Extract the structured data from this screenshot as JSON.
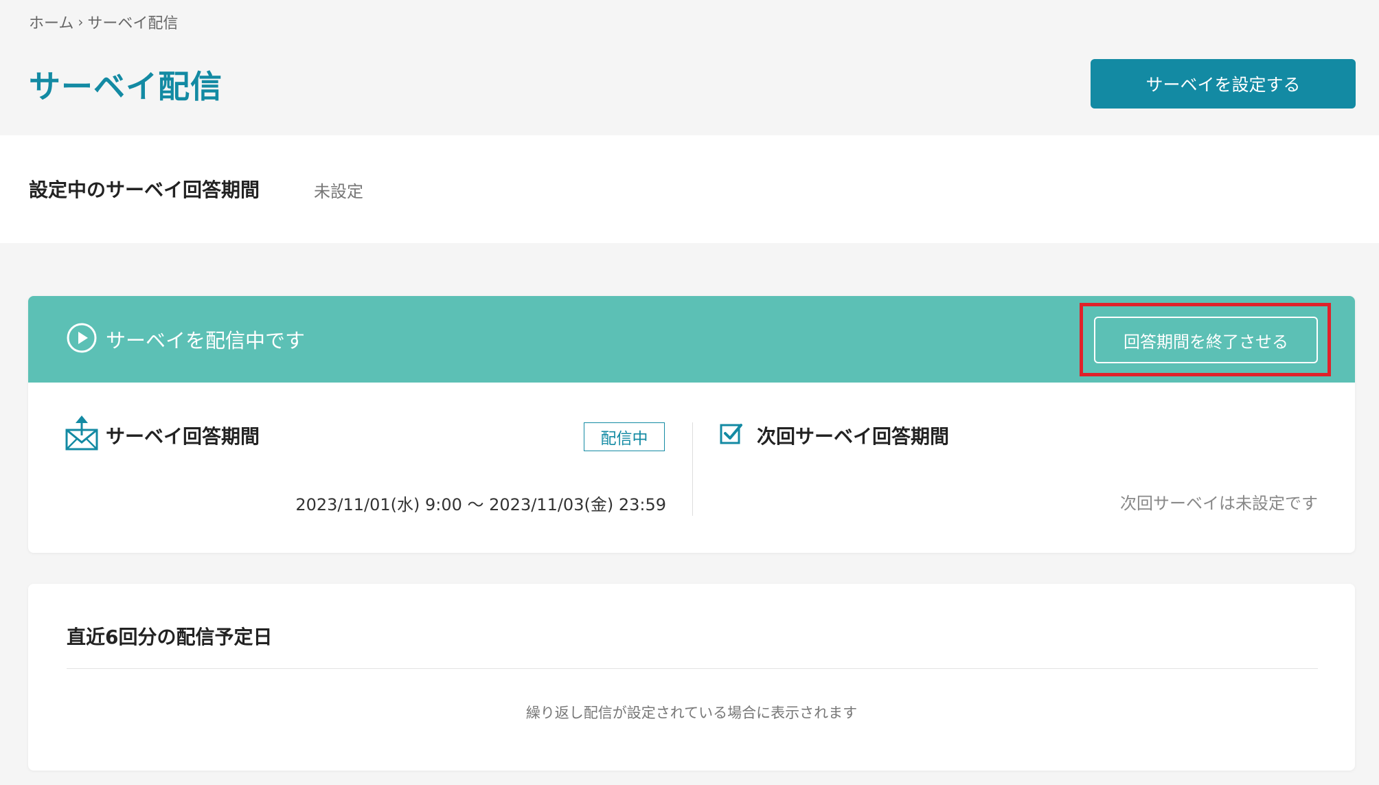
{
  "breadcrumb": {
    "home": "ホーム",
    "separator": "›",
    "current": "サーベイ配信"
  },
  "header": {
    "title": "サーベイ配信",
    "setup_button": "サーベイを設定する"
  },
  "period": {
    "label": "設定中のサーベイ回答期間",
    "value": "未設定"
  },
  "status_card": {
    "status_text": "サーベイを配信中です",
    "end_button": "回答期間を終了させる",
    "current": {
      "title": "サーベイ回答期間",
      "badge": "配信中",
      "range": "2023/11/01(水) 9:00 〜 2023/11/03(金) 23:59"
    },
    "next": {
      "title": "次回サーベイ回答期間",
      "empty": "次回サーベイは未設定です"
    }
  },
  "schedule": {
    "title": "直近6回分の配信予定日",
    "empty": "繰り返し配信が設定されている場合に表示されます"
  },
  "colors": {
    "brand": "#138aa3",
    "status_bar": "#5cc0b5",
    "highlight": "#e0212a"
  },
  "icons": {
    "status": "play-circle-icon",
    "current": "mail-upload-icon",
    "next": "checkbox-icon"
  }
}
